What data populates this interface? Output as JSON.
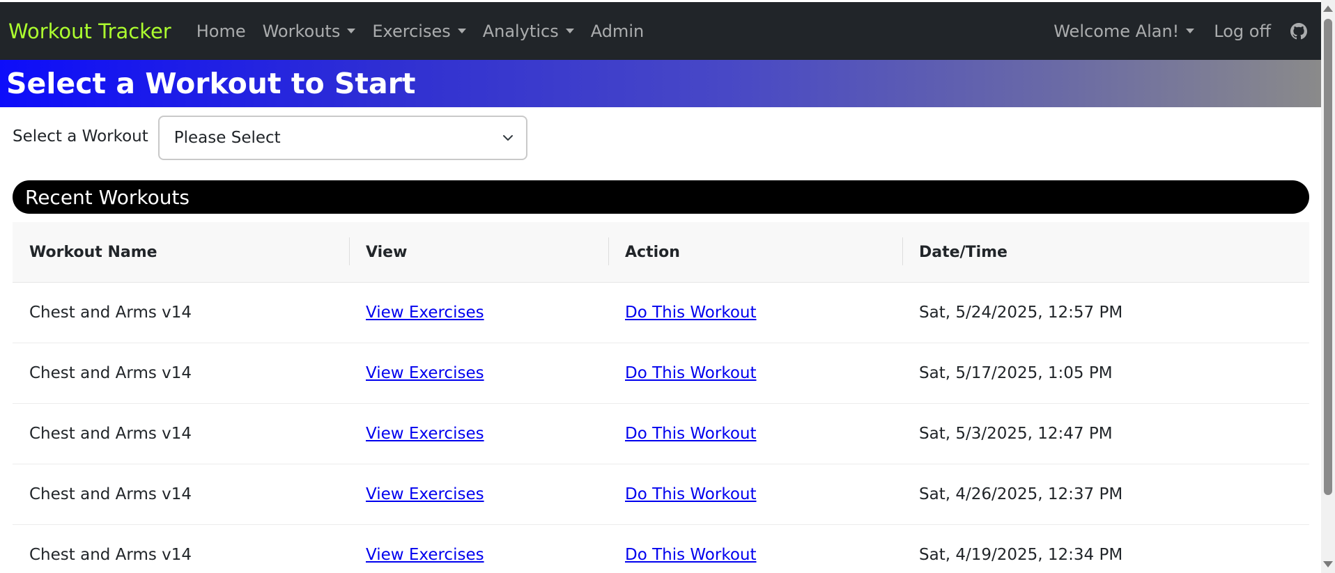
{
  "navbar": {
    "brand": "Workout Tracker",
    "items": [
      {
        "label": "Home"
      },
      {
        "label": "Workouts"
      },
      {
        "label": "Exercises"
      },
      {
        "label": "Analytics"
      },
      {
        "label": "Admin"
      }
    ],
    "welcome": "Welcome Alan!",
    "logoff": "Log off",
    "github_icon": "github-icon"
  },
  "banner": {
    "title": "Select a Workout to Start"
  },
  "workout_select": {
    "label": "Select a Workout",
    "value": "Please Select"
  },
  "recent": {
    "title": "Recent Workouts",
    "columns": [
      "Workout Name",
      "View",
      "Action",
      "Date/Time"
    ],
    "rows": [
      {
        "name": "Chest and Arms v14",
        "view": "View Exercises",
        "action": "Do This Workout",
        "datetime": "Sat, 5/24/2025, 12:57 PM"
      },
      {
        "name": "Chest and Arms v14",
        "view": "View Exercises",
        "action": "Do This Workout",
        "datetime": "Sat, 5/17/2025, 1:05 PM"
      },
      {
        "name": "Chest and Arms v14",
        "view": "View Exercises",
        "action": "Do This Workout",
        "datetime": "Sat, 5/3/2025, 12:47 PM"
      },
      {
        "name": "Chest and Arms v14",
        "view": "View Exercises",
        "action": "Do This Workout",
        "datetime": "Sat, 4/26/2025, 12:37 PM"
      },
      {
        "name": "Chest and Arms v14",
        "view": "View Exercises",
        "action": "Do This Workout",
        "datetime": "Sat, 4/19/2025, 12:34 PM"
      }
    ]
  },
  "colors": {
    "brand": "#adff2f",
    "navbar_bg": "#212529",
    "banner_start": "#0d0dfa",
    "banner_end": "#8a8a8a",
    "link": "#0000ee"
  }
}
